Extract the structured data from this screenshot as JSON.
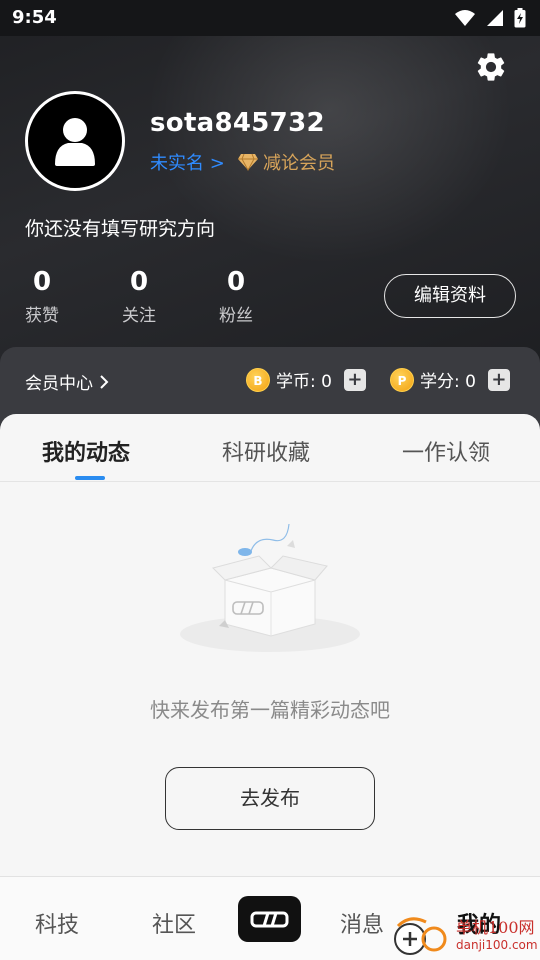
{
  "status_bar": {
    "time": "9:54",
    "icons": [
      "wifi-icon",
      "signal-icon",
      "battery-charging-icon"
    ]
  },
  "header": {
    "settings_icon": "gear-icon",
    "avatar_icon": "user-avatar-icon",
    "username": "sota845732",
    "verify_link": "未实名 >",
    "member_icon": "diamond-icon",
    "member_label": "减论会员",
    "research_direction": "你还没有填写研究方向",
    "stats": [
      {
        "value": "0",
        "label": "获赞"
      },
      {
        "value": "0",
        "label": "关注"
      },
      {
        "value": "0",
        "label": "粉丝"
      }
    ],
    "edit_profile_label": "编辑资料"
  },
  "membership": {
    "center_label": "会员中心",
    "coins": [
      {
        "icon_text": "B",
        "label": "学币: 0"
      },
      {
        "icon_text": "P",
        "label": "学分: 0"
      }
    ],
    "plus": "+"
  },
  "tabs": {
    "items": [
      "我的动态",
      "科研收藏",
      "一作认领"
    ],
    "active_index": 0
  },
  "empty_state": {
    "illustration": "empty-box-icon",
    "message": "快来发布第一篇精彩动态吧",
    "button_label": "去发布"
  },
  "bottom_nav": {
    "items": [
      "科技",
      "社区",
      "消息",
      "我的"
    ],
    "center_icon": "app-logo-icon",
    "active": "我的"
  },
  "watermark": {
    "line1": "单机100网",
    "line2": "danji100.com"
  },
  "colors": {
    "accent_blue": "#2a8cf0",
    "link_blue": "#2f8bff",
    "member_gold": "#d7a45a",
    "coin_yellow": "#f5b325",
    "header_dark": "#222326"
  }
}
